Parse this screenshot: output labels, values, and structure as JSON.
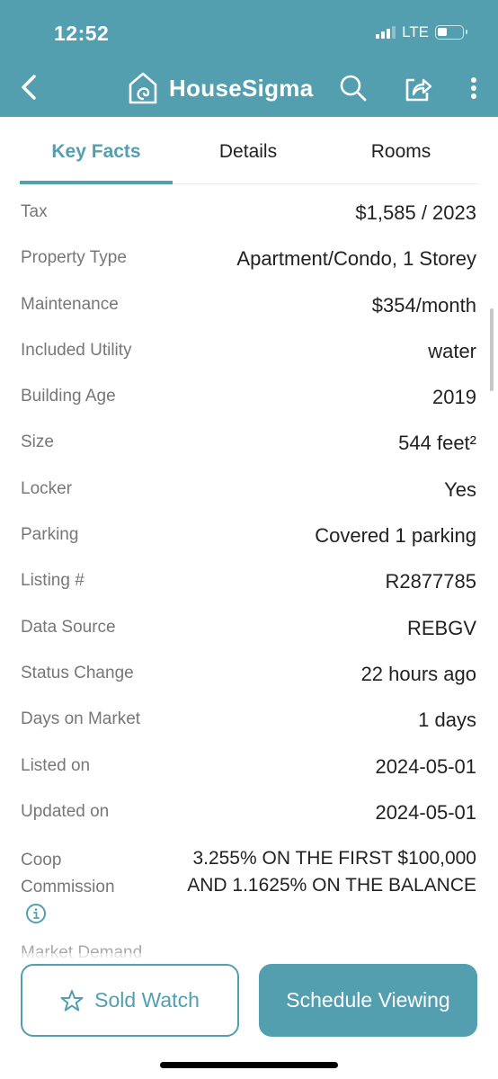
{
  "status_bar": {
    "time": "12:52",
    "network": "LTE",
    "battery_level": 0.3,
    "signal_bars": 3,
    "signal_bars_max": 4
  },
  "nav": {
    "brand": "HouseSigma"
  },
  "tabs": [
    {
      "label": "Key Facts",
      "active": true
    },
    {
      "label": "Details",
      "active": false
    },
    {
      "label": "Rooms",
      "active": false
    }
  ],
  "facts": [
    {
      "label": "Tax",
      "value": "$1,585 / 2023"
    },
    {
      "label": "Property Type",
      "value": "Apartment/Condo, 1 Storey"
    },
    {
      "label": "Maintenance",
      "value": "$354/month"
    },
    {
      "label": "Included Utility",
      "value": "water"
    },
    {
      "label": "Building Age",
      "value": "2019"
    },
    {
      "label": "Size",
      "value": "544 feet²"
    },
    {
      "label": "Locker",
      "value": "Yes"
    },
    {
      "label": "Parking",
      "value": "Covered 1 parking"
    },
    {
      "label": "Listing #",
      "value": "R2877785"
    },
    {
      "label": "Data Source",
      "value": "REBGV"
    },
    {
      "label": "Status Change",
      "value": "22 hours ago"
    },
    {
      "label": "Days on Market",
      "value": "1 days"
    },
    {
      "label": "Listed on",
      "value": "2024-05-01"
    },
    {
      "label": "Updated on",
      "value": "2024-05-01"
    }
  ],
  "coop": {
    "label_line1": "Coop",
    "label_line2": "Commission",
    "value_line1": "3.255% ON THE FIRST $100,000",
    "value_line2": "AND 1.1625% ON THE BALANCE"
  },
  "market_demand_label": "Market Demand",
  "footer": {
    "watch_label": "Sold Watch",
    "schedule_label": "Schedule Viewing"
  },
  "colors": {
    "accent": "#539fb0",
    "label": "#777777",
    "value": "#222222"
  }
}
